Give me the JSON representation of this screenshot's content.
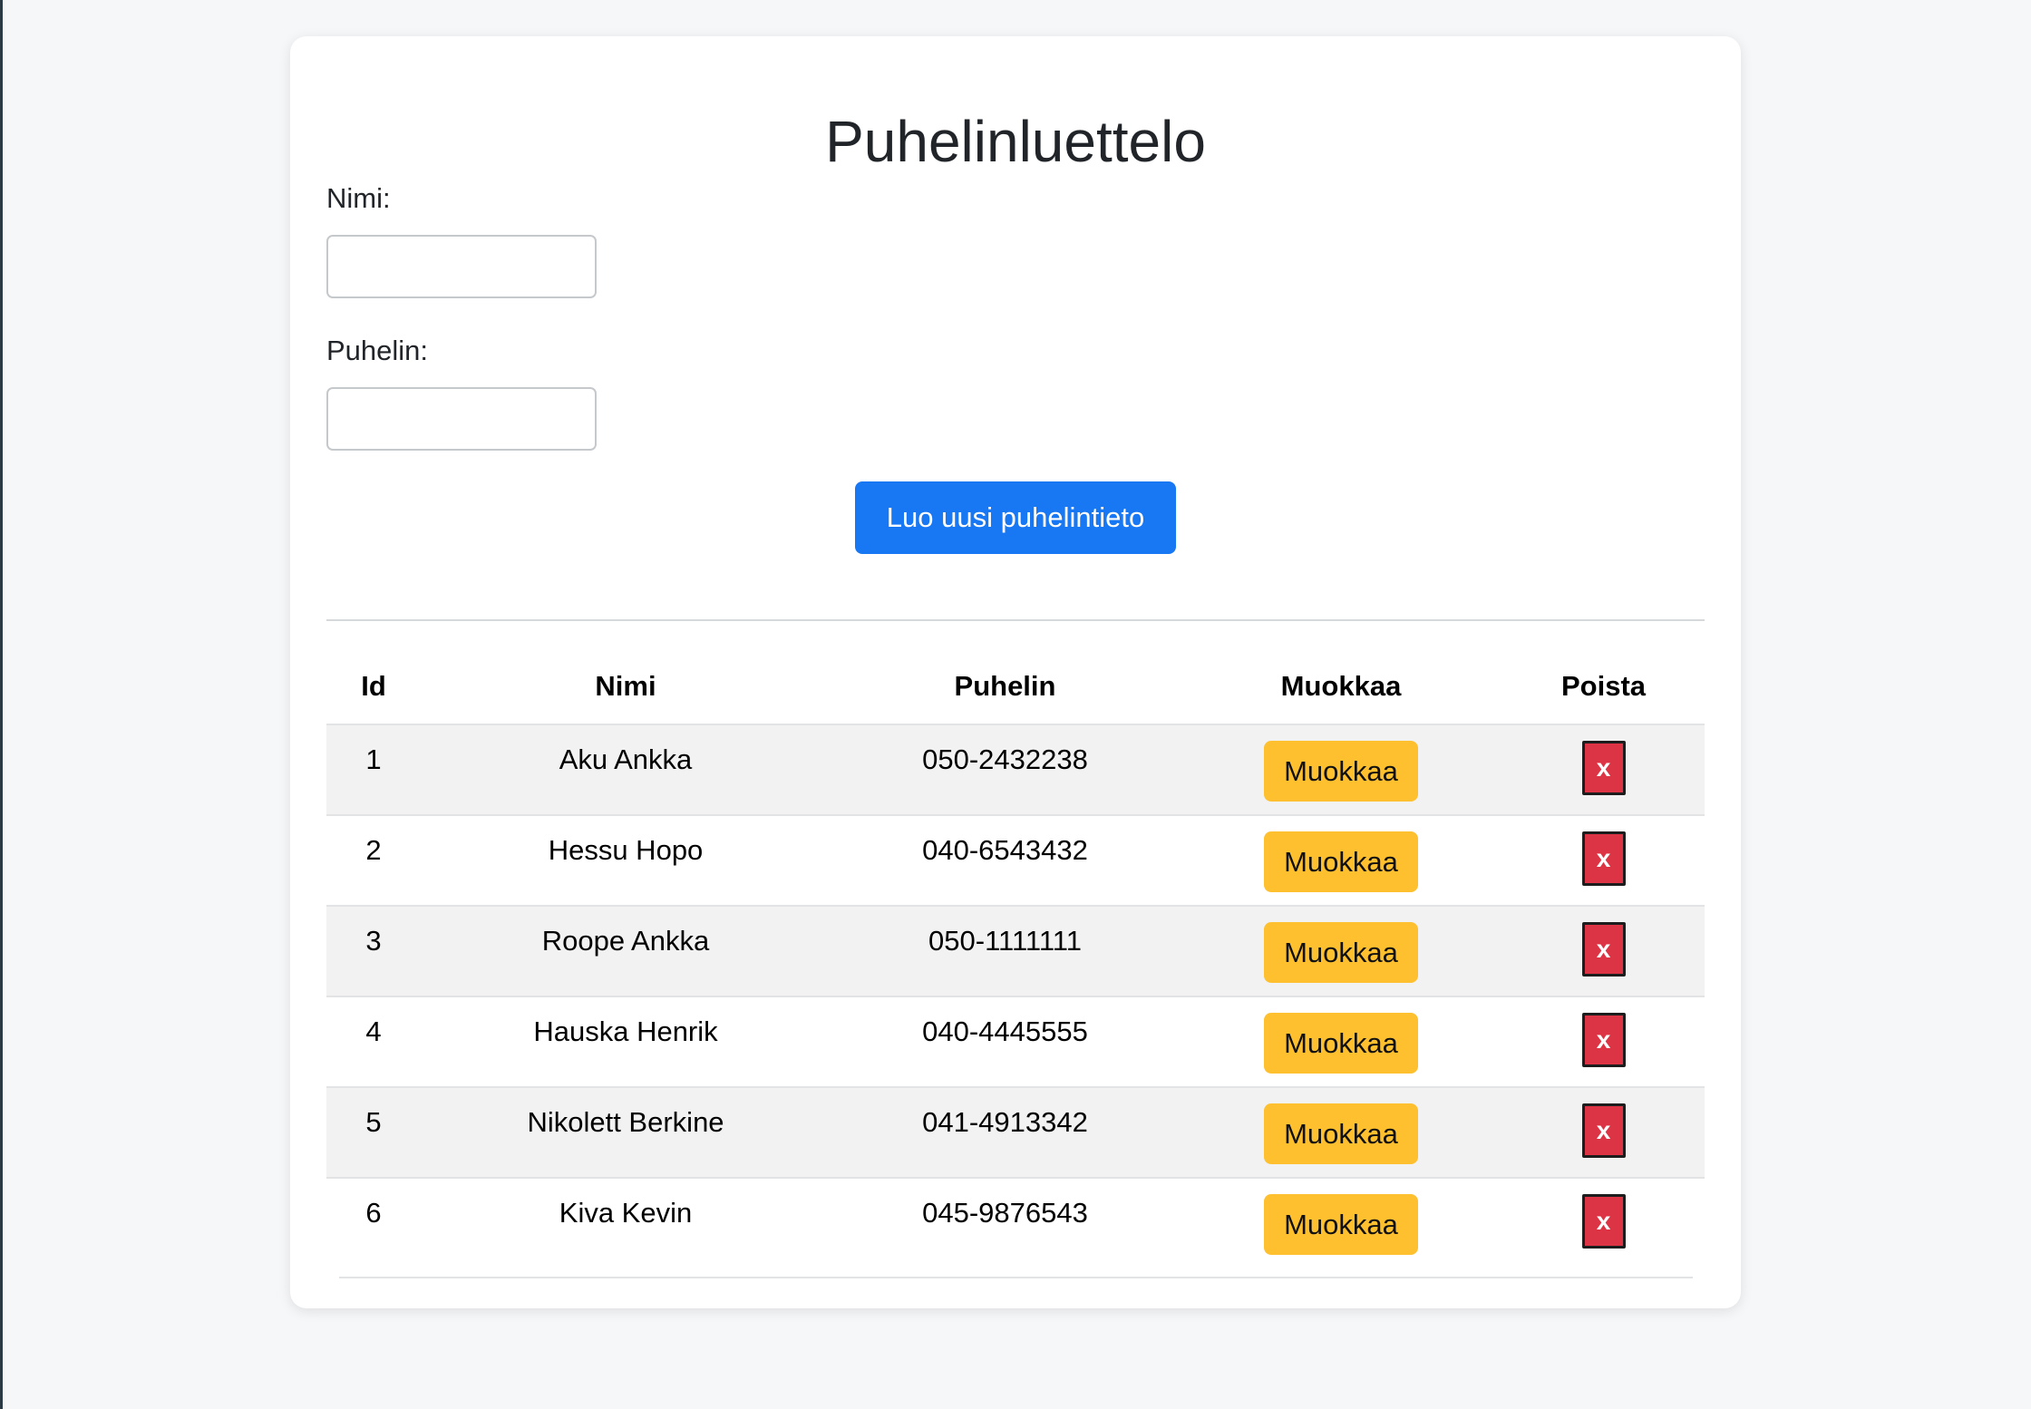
{
  "page": {
    "title": "Puhelinluettelo"
  },
  "form": {
    "name_label": "Nimi:",
    "name_value": "",
    "phone_label": "Puhelin:",
    "phone_value": "",
    "submit_label": "Luo uusi puhelintieto"
  },
  "table": {
    "headers": {
      "id": "Id",
      "name": "Nimi",
      "phone": "Puhelin",
      "edit": "Muokkaa",
      "delete": "Poista"
    },
    "rows": [
      {
        "id": "1",
        "name": "Aku Ankka",
        "phone": "050-2432238",
        "edit_label": "Muokkaa",
        "delete_label": "x"
      },
      {
        "id": "2",
        "name": "Hessu Hopo",
        "phone": "040-6543432",
        "edit_label": "Muokkaa",
        "delete_label": "x"
      },
      {
        "id": "3",
        "name": "Roope Ankka",
        "phone": "050-1111111",
        "edit_label": "Muokkaa",
        "delete_label": "x"
      },
      {
        "id": "4",
        "name": "Hauska Henrik",
        "phone": "040-4445555",
        "edit_label": "Muokkaa",
        "delete_label": "x"
      },
      {
        "id": "5",
        "name": "Nikolett Berkine",
        "phone": "041-4913342",
        "edit_label": "Muokkaa",
        "delete_label": "x"
      },
      {
        "id": "6",
        "name": "Kiva Kevin",
        "phone": "045-9876543",
        "edit_label": "Muokkaa",
        "delete_label": "x"
      }
    ]
  },
  "colors": {
    "primary": "#1877f2",
    "edit": "#fec02f",
    "delete": "#dc3445",
    "background": "#f6f7f9",
    "stripe": "#f2f2f2"
  }
}
